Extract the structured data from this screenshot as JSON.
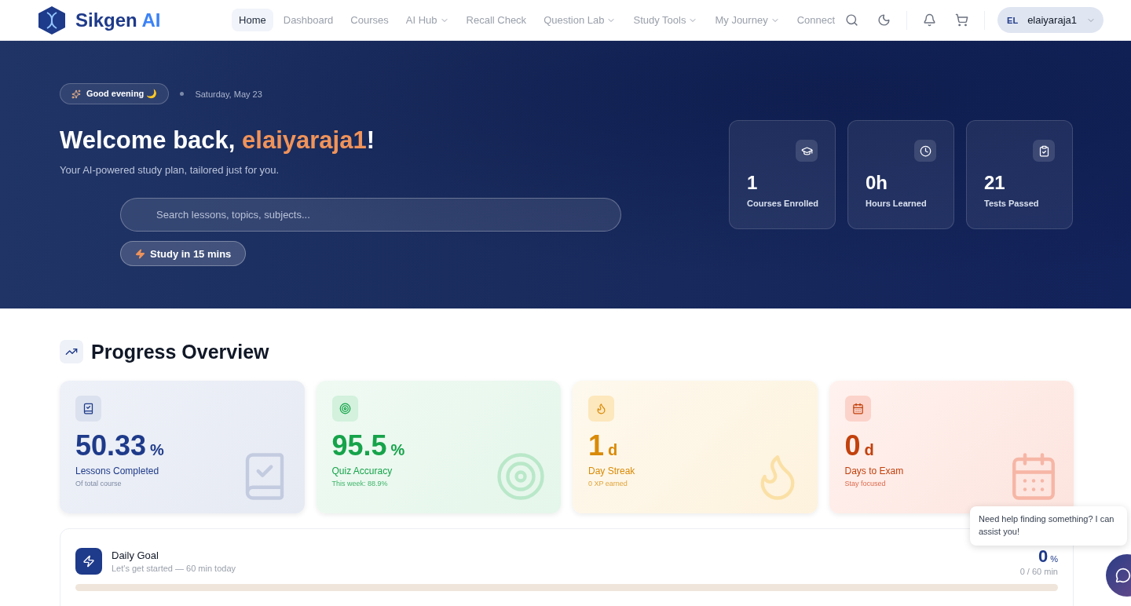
{
  "brand": {
    "name": "Sikgen",
    "suffix": "AI"
  },
  "nav": [
    {
      "label": "Home",
      "selected": true,
      "dropdown": false
    },
    {
      "label": "Dashboard",
      "selected": false,
      "dropdown": false
    },
    {
      "label": "Courses",
      "selected": false,
      "dropdown": false
    },
    {
      "label": "AI Hub",
      "selected": false,
      "dropdown": true
    },
    {
      "label": "Recall Check",
      "selected": false,
      "dropdown": false
    },
    {
      "label": "Question Lab",
      "selected": false,
      "dropdown": true
    },
    {
      "label": "Study Tools",
      "selected": false,
      "dropdown": true
    },
    {
      "label": "My Journey",
      "selected": false,
      "dropdown": true
    },
    {
      "label": "Connect",
      "selected": false,
      "dropdown": false
    }
  ],
  "user": {
    "initials": "EL",
    "name": "elaiyaraja1"
  },
  "hero": {
    "greeting": "Good evening 🌙",
    "date": "Saturday, May 23",
    "title_prefix": "Welcome back, ",
    "title_name": "elaiyaraja1",
    "title_suffix": "!",
    "subtitle": "Your AI-powered study plan, tailored just for you.",
    "search": {
      "placeholder": "Search lessons, topics, subjects..."
    },
    "quick_button": "Study in 15 mins",
    "stats": [
      {
        "kind": "courses",
        "value": "1",
        "label": "Courses Enrolled"
      },
      {
        "kind": "hours",
        "value": "0h",
        "label": "Hours Learned"
      },
      {
        "kind": "tests",
        "value": "21",
        "label": "Tests Passed"
      }
    ]
  },
  "progress": {
    "title": "Progress Overview",
    "cards": [
      {
        "kind": "lessons",
        "value": "50.33",
        "unit": "%",
        "label": "Lessons Completed",
        "note": "Of total course"
      },
      {
        "kind": "quiz",
        "value": "95.5",
        "unit": "%",
        "label": "Quiz Accuracy",
        "note": "This week: 88.9%"
      },
      {
        "kind": "streak",
        "value": "1",
        "unit": "d",
        "label": "Day Streak",
        "note": "0 XP earned"
      },
      {
        "kind": "exam",
        "value": "0",
        "unit": "d",
        "label": "Days to Exam",
        "note": "Stay focused"
      }
    ]
  },
  "daily_goal": {
    "title": "Daily Goal",
    "subtitle": "Let's get started — 60 min today",
    "percent": "0",
    "unit": "%",
    "minutes": "0 / 60 min",
    "level": 0
  },
  "chat": {
    "message": "Need help finding something? I can assist you!"
  }
}
